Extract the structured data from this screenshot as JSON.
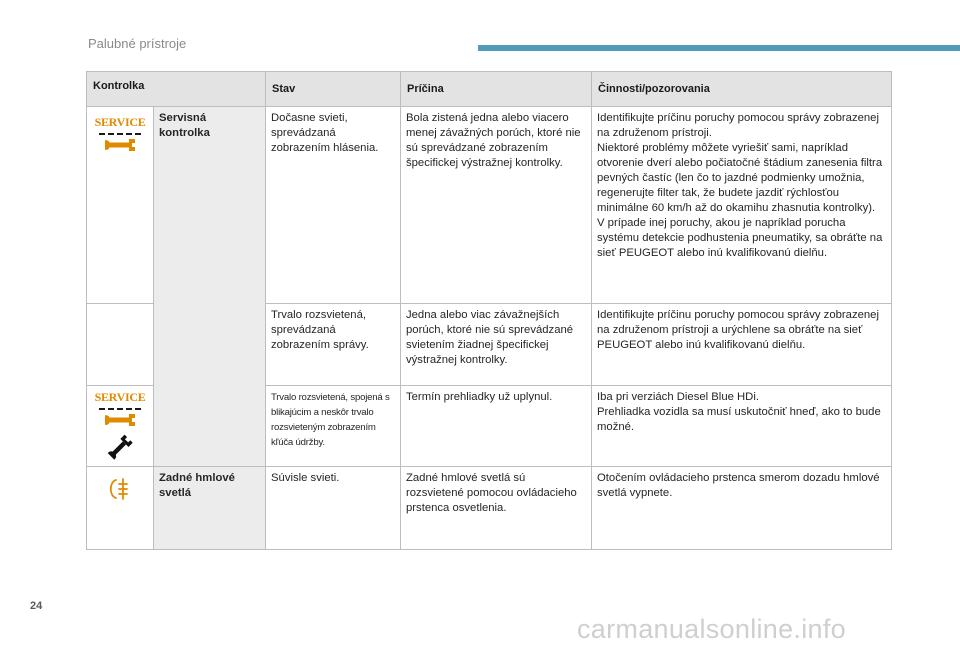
{
  "header": {
    "title": "Palubné prístroje",
    "accent_color": "#4f9bb8"
  },
  "table": {
    "columns": [
      "Kontrolka",
      "Stav",
      "Príčina",
      "Činnosti/pozorovania"
    ],
    "service_group": {
      "icon_text": "SERVICE",
      "icon_color": "#e08a00",
      "name": "Servisná kontrolka",
      "rows": [
        {
          "state": "Dočasne svieti, sprevádzaná zobrazením hlásenia.",
          "cause": "Bola zistená jedna alebo viacero menej závažných porúch, ktoré nie sú sprevádzané zobrazením špecifickej výstražnej kontrolky.",
          "action": "Identifikujte príčinu poruchy pomocou správy zobrazenej na združenom prístroji.\nNiektoré problémy môžete vyriešiť sami, napríklad otvorenie dverí alebo počiatočné štádium zanesenia filtra pevných častíc (len čo to jazdné podmienky umožnia, regenerujte filter tak, že budete jazdiť rýchlosťou minimálne 60 km/h až do okamihu zhasnutia kontrolky).\nV prípade inej poruchy, akou je napríklad porucha systému detekcie podhustenia pneumatiky, sa obráťte na sieť PEUGEOT alebo inú kvalifikovanú dielňu."
        },
        {
          "state": "Trvalo rozsvietená, sprevádzaná zobrazením správy.",
          "cause": "Jedna alebo viac závažnejších porúch, ktoré nie sú sprevádzané svietením žiadnej špecifickej výstražnej kontrolky.",
          "action": "Identifikujte príčinu poruchy pomocou správy zobrazenej na združenom prístroji a urýchlene sa obráťte na sieť PEUGEOT alebo inú kvalifikovanú dielňu."
        },
        {
          "state": "Trvalo rozsvietená, spojená s blikajúcim a neskôr trvalo rozsvieteným zobrazením kľúča údržby.",
          "cause": "Termín prehliadky už uplynul.",
          "action": "Iba pri verziách Diesel Blue HDi.\nPrehliadka vozidla sa musí uskutočniť hneď, ako to bude možné."
        }
      ]
    },
    "fog_row": {
      "icon": "rear-fog-light-icon",
      "name": "Zadné hmlové svetlá",
      "state": "Súvisle svieti.",
      "cause": "Zadné hmlové svetlá sú rozsvietené pomocou ovládacieho prstenca osvetlenia.",
      "action": "Otočením ovládacieho prstenca smerom dozadu hmlové svetlá vypnete."
    }
  },
  "footer": {
    "page_number": "24",
    "watermark": "carmanualsonline.info"
  }
}
